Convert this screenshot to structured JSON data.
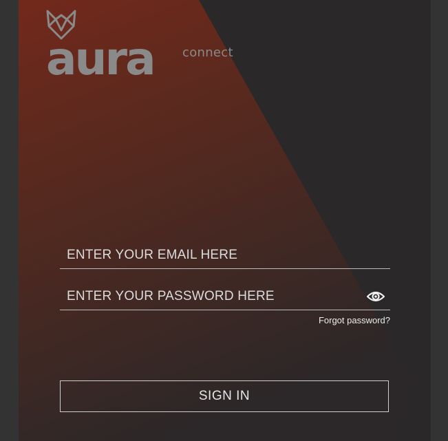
{
  "brand": {
    "logo_word": "aura",
    "logo_suffix": "connect",
    "colors": {
      "accent": "#7a2a1a",
      "background": "#2a2829",
      "logo_grey": "#8a8a8a"
    }
  },
  "form": {
    "email_placeholder": "ENTER YOUR EMAIL HERE",
    "password_placeholder": "ENTER YOUR PASSWORD HERE",
    "show_password_icon": "eye-icon",
    "forgot_label": "Forgot password?",
    "signin_label": "SIGN IN"
  }
}
